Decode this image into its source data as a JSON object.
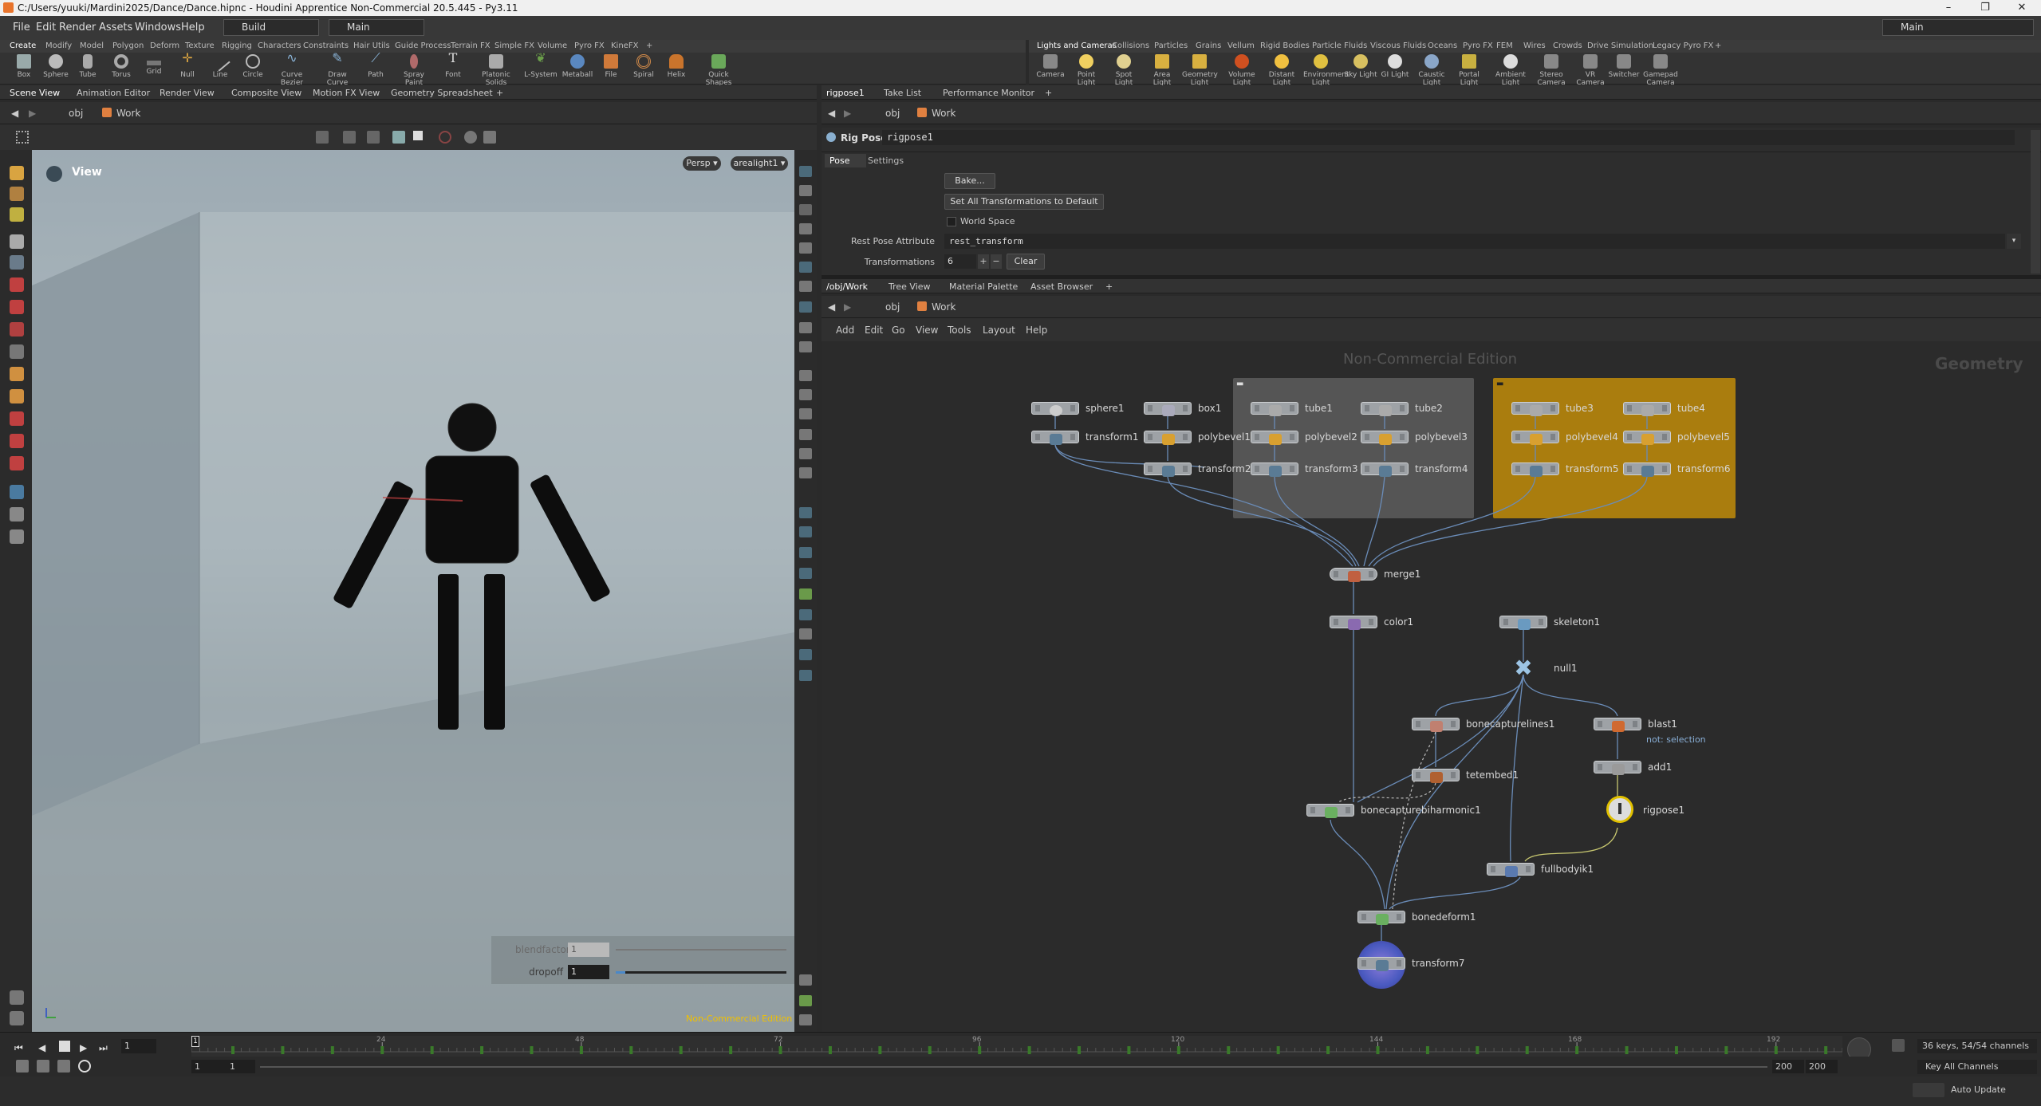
{
  "window": {
    "title": "C:/Users/yuuki/Mardini2025/Dance/Dance.hipnc - Houdini Apprentice Non-Commercial 20.5.445 - Py3.11",
    "controls": [
      "–",
      "❐",
      "✕"
    ]
  },
  "menu": {
    "items": [
      "File",
      "Edit",
      "Render",
      "Assets",
      "Windows",
      "Help"
    ],
    "desktop": "Build",
    "context": "Main",
    "right_desktop": "Main"
  },
  "shelf_left": {
    "tabs": [
      "Create",
      "Modify",
      "Model",
      "Polygon",
      "Deform",
      "Texture",
      "Rigging",
      "Characters",
      "Constraints",
      "Hair Utils",
      "Guide Process",
      "Terrain FX",
      "Simple FX",
      "Volume",
      "Pyro FX",
      "KineFX",
      "+"
    ],
    "tools": [
      "Box",
      "Sphere",
      "Tube",
      "Torus",
      "Grid",
      "Null",
      "Line",
      "Circle",
      "Curve Bezier",
      "Draw Curve",
      "Path",
      "Spray Paint",
      "Font",
      "Platonic Solids",
      "L-System",
      "Metaball",
      "File",
      "Spiral",
      "Helix",
      "Quick Shapes"
    ]
  },
  "shelf_right": {
    "tabs": [
      "Lights and Cameras",
      "Collisions",
      "Particles",
      "Grains",
      "Vellum",
      "Rigid Bodies",
      "Particle Fluids",
      "Viscous Fluids",
      "Oceans",
      "Pyro FX",
      "FEM",
      "Wires",
      "Crowds",
      "Drive Simulation",
      "Legacy Pyro FX",
      "+"
    ],
    "tools": [
      "Camera",
      "Point Light",
      "Spot Light",
      "Area Light",
      "Geometry Light",
      "Volume Light",
      "Distant Light",
      "Environment Light",
      "Sky Light",
      "GI Light",
      "Caustic Light",
      "Portal Light",
      "Ambient Light",
      "Stereo Camera",
      "VR Camera",
      "Switcher",
      "Gamepad Camera"
    ]
  },
  "left_pane": {
    "tabs": [
      "Scene View",
      "Animation Editor",
      "Render View",
      "Composite View",
      "Motion FX View",
      "Geometry Spreadsheet",
      "+"
    ],
    "path": [
      "obj",
      "Work"
    ],
    "view_label": "View",
    "camera_menu": "Persp ▾",
    "light_menu": "arealight1 ▾",
    "watermark": "Non-Commercial Edition",
    "handles": [
      {
        "label": "blendfactor",
        "value": "1"
      },
      {
        "label": "dropoff",
        "value": "1"
      }
    ]
  },
  "param_pane": {
    "tabs": [
      "rigpose1",
      "Take List",
      "Performance Monitor",
      "+"
    ],
    "path": [
      "obj",
      "Work"
    ],
    "node_type": "Rig Pose",
    "node_name": "rigpose1",
    "subtabs": [
      "Pose",
      "Settings"
    ],
    "bake_label": "Bake...",
    "set_default_label": "Set All Transformations to Default",
    "world_space_label": "World Space",
    "rest_pose_label": "Rest Pose Attribute",
    "rest_pose_value": "rest_transform",
    "transformations_label": "Transformations",
    "transformations_value": "6",
    "clear_label": "Clear"
  },
  "network_pane": {
    "tabs": [
      "/obj/Work",
      "Tree View",
      "Material Palette",
      "Asset Browser",
      "+"
    ],
    "path": [
      "obj",
      "Work"
    ],
    "menu": [
      "Add",
      "Edit",
      "Go",
      "View",
      "Tools",
      "Layout",
      "Help"
    ],
    "watermark": "Non-Commercial Edition",
    "context_label": "Geometry",
    "nodes": [
      {
        "name": "sphere1"
      },
      {
        "name": "box1"
      },
      {
        "name": "tube1"
      },
      {
        "name": "tube2"
      },
      {
        "name": "tube3"
      },
      {
        "name": "tube4"
      },
      {
        "name": "transform1"
      },
      {
        "name": "polybevel1"
      },
      {
        "name": "polybevel2"
      },
      {
        "name": "polybevel3"
      },
      {
        "name": "polybevel4"
      },
      {
        "name": "polybevel5"
      },
      {
        "name": "transform2"
      },
      {
        "name": "transform3"
      },
      {
        "name": "transform4"
      },
      {
        "name": "transform5"
      },
      {
        "name": "transform6"
      },
      {
        "name": "merge1"
      },
      {
        "name": "color1"
      },
      {
        "name": "skeleton1"
      },
      {
        "name": "null1"
      },
      {
        "name": "bonecapturelines1"
      },
      {
        "name": "blast1"
      },
      {
        "name": "tetembed1"
      },
      {
        "name": "add1"
      },
      {
        "name": "bonecapturebiharmonic1"
      },
      {
        "name": "rigpose1"
      },
      {
        "name": "fullbodyik1"
      },
      {
        "name": "bonedeform1"
      },
      {
        "name": "transform7"
      }
    ],
    "blast_note": "not: selection",
    "box_colors": {
      "gray": "#5a5a5a",
      "gold": "#b8860b"
    }
  },
  "timeline": {
    "current_frame": "1",
    "start": "1",
    "start2": "1",
    "end": "200",
    "end2": "200",
    "marks": [
      "24",
      "48",
      "72",
      "96",
      "120",
      "144",
      "168",
      "192"
    ],
    "frame_marker": "1",
    "keys_info": "36 keys, 54/54 channels",
    "key_mode": "Key All Channels",
    "auto_update": "Auto Update"
  }
}
